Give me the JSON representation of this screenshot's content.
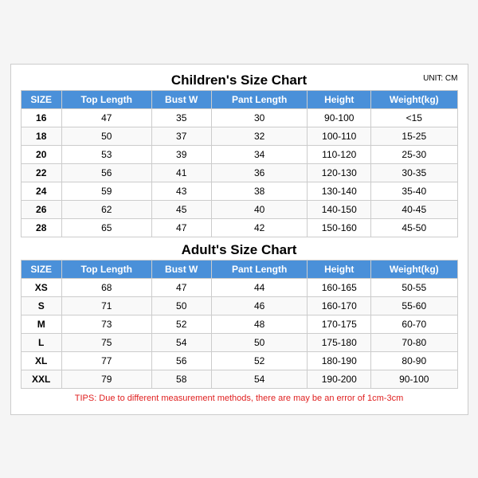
{
  "title": "Children's Size Chart",
  "unit": "UNIT: CM",
  "children": {
    "section_title": "Children's Size Chart",
    "headers": [
      "SIZE",
      "Top Length",
      "Bust W",
      "Pant Length",
      "Height",
      "Weight(kg)"
    ],
    "rows": [
      [
        "16",
        "47",
        "35",
        "30",
        "90-100",
        "<15"
      ],
      [
        "18",
        "50",
        "37",
        "32",
        "100-110",
        "15-25"
      ],
      [
        "20",
        "53",
        "39",
        "34",
        "110-120",
        "25-30"
      ],
      [
        "22",
        "56",
        "41",
        "36",
        "120-130",
        "30-35"
      ],
      [
        "24",
        "59",
        "43",
        "38",
        "130-140",
        "35-40"
      ],
      [
        "26",
        "62",
        "45",
        "40",
        "140-150",
        "40-45"
      ],
      [
        "28",
        "65",
        "47",
        "42",
        "150-160",
        "45-50"
      ]
    ]
  },
  "adults": {
    "section_title": "Adult's Size Chart",
    "headers": [
      "SIZE",
      "Top Length",
      "Bust W",
      "Pant Length",
      "Height",
      "Weight(kg)"
    ],
    "rows": [
      [
        "XS",
        "68",
        "47",
        "44",
        "160-165",
        "50-55"
      ],
      [
        "S",
        "71",
        "50",
        "46",
        "160-170",
        "55-60"
      ],
      [
        "M",
        "73",
        "52",
        "48",
        "170-175",
        "60-70"
      ],
      [
        "L",
        "75",
        "54",
        "50",
        "175-180",
        "70-80"
      ],
      [
        "XL",
        "77",
        "56",
        "52",
        "180-190",
        "80-90"
      ],
      [
        "XXL",
        "79",
        "58",
        "54",
        "190-200",
        "90-100"
      ]
    ]
  },
  "tips": "TIPS: Due to different measurement methods, there are may be an error of 1cm-3cm"
}
